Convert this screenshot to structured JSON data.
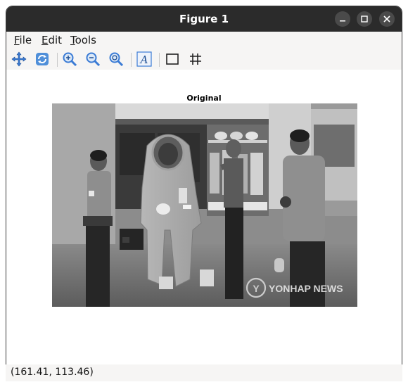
{
  "window": {
    "title": "Figure 1"
  },
  "menubar": {
    "file": {
      "accel": "F",
      "rest": "ile"
    },
    "edit": {
      "accel": "E",
      "rest": "dit"
    },
    "tools": {
      "accel": "T",
      "rest": "ools"
    }
  },
  "toolbar": {
    "icons": [
      "move-icon",
      "refresh-icon",
      "zoom-in-icon",
      "zoom-out-icon",
      "zoom-fit-icon",
      "text-icon",
      "rectangle-icon",
      "grid-icon"
    ]
  },
  "figure": {
    "axes_title": "Original",
    "watermark": "YONHAP NEWS"
  },
  "status": {
    "coords": "(161.41, 113.46)"
  },
  "colors": {
    "titlebar": "#2b2b2b",
    "accent": "#3a7bd5",
    "background": "#f6f5f4"
  }
}
